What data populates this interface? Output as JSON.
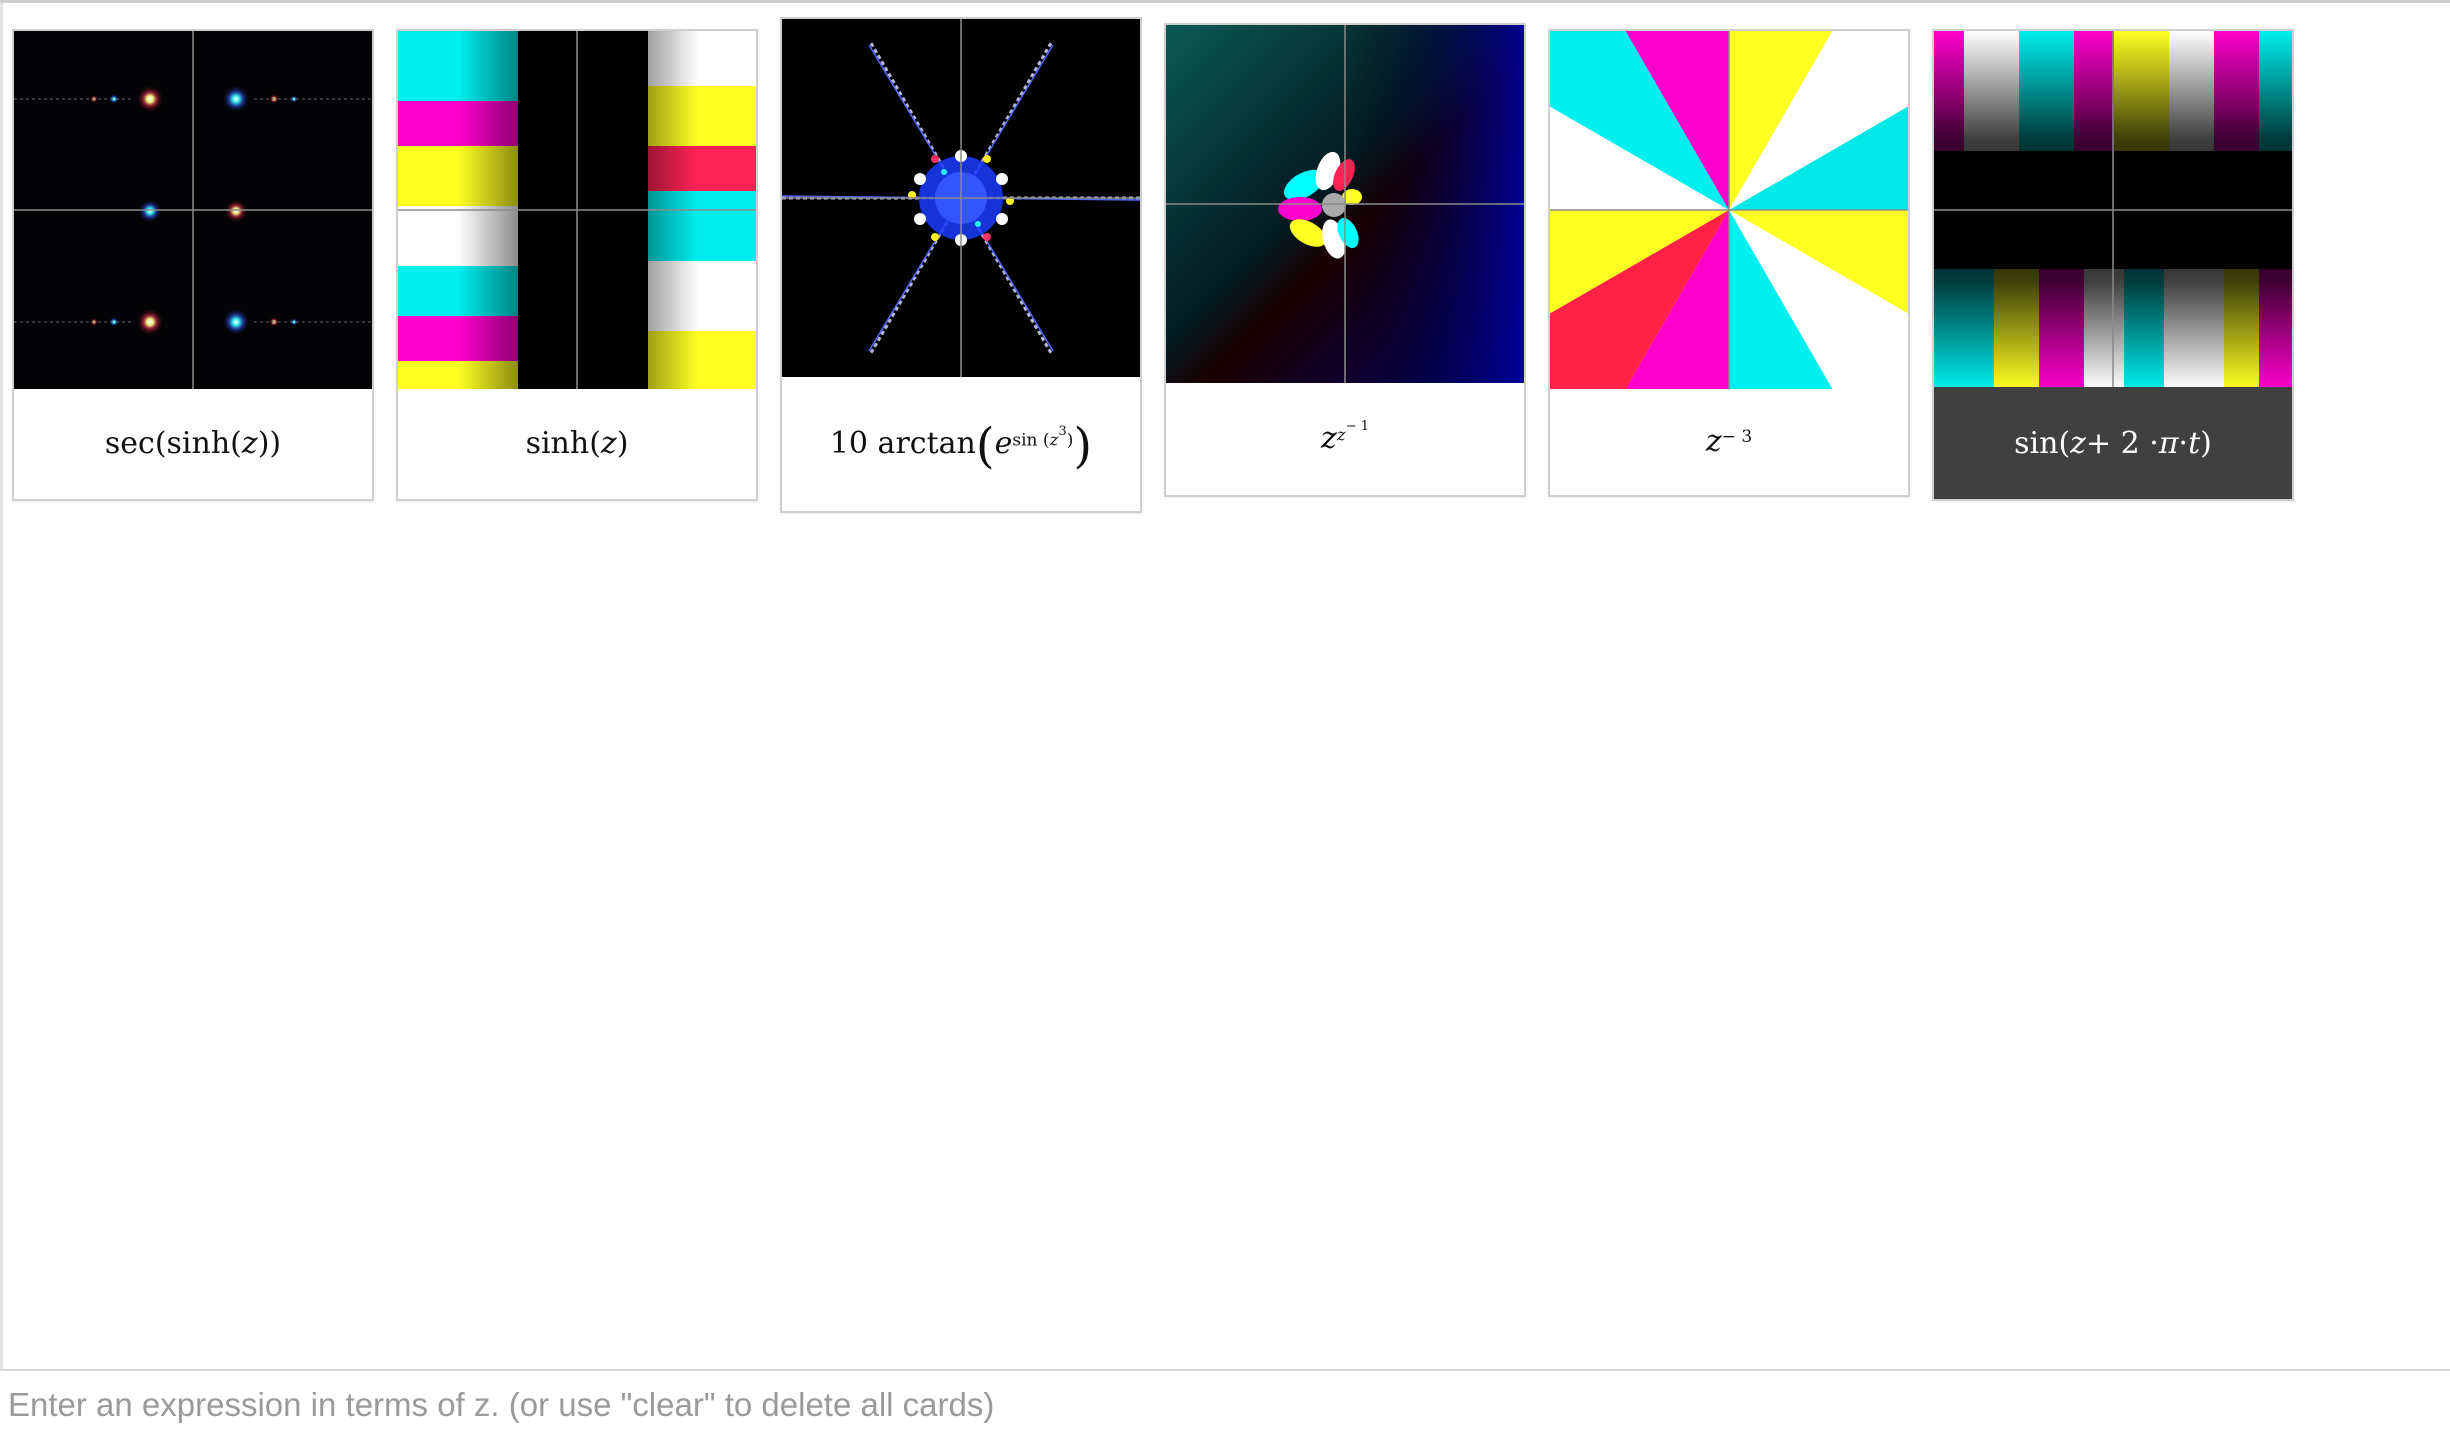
{
  "cards": [
    {
      "expression_parts": [
        "sec(sinh(",
        "z",
        "))"
      ],
      "selected": false,
      "plot_icon": "domain-coloring-plot"
    },
    {
      "expression_parts": [
        "sinh(",
        "z",
        ")"
      ],
      "selected": false,
      "plot_icon": "domain-coloring-plot"
    },
    {
      "expression_parts": [
        "10 arctan",
        "(",
        "e",
        "sin (",
        "z",
        "3",
        ")",
        ")"
      ],
      "selected": false,
      "plot_icon": "domain-coloring-plot"
    },
    {
      "expression_parts": [
        "z",
        "z",
        "− 1"
      ],
      "selected": false,
      "plot_icon": "domain-coloring-plot"
    },
    {
      "expression_parts": [
        "z",
        "− 3"
      ],
      "selected": false,
      "plot_icon": "domain-coloring-plot"
    },
    {
      "expression_parts": [
        "sin(",
        "z",
        " + 2 · ",
        "π",
        " · ",
        "t",
        ")"
      ],
      "selected": true,
      "plot_icon": "domain-coloring-plot"
    }
  ],
  "input": {
    "placeholder": "Enter an expression in terms of z. (or use \"clear\" to delete all cards)",
    "value": ""
  },
  "colors": {
    "selected_caption_bg": "#404040",
    "card_border": "#cfcfcf",
    "axis_line": "#9a9a9a"
  }
}
